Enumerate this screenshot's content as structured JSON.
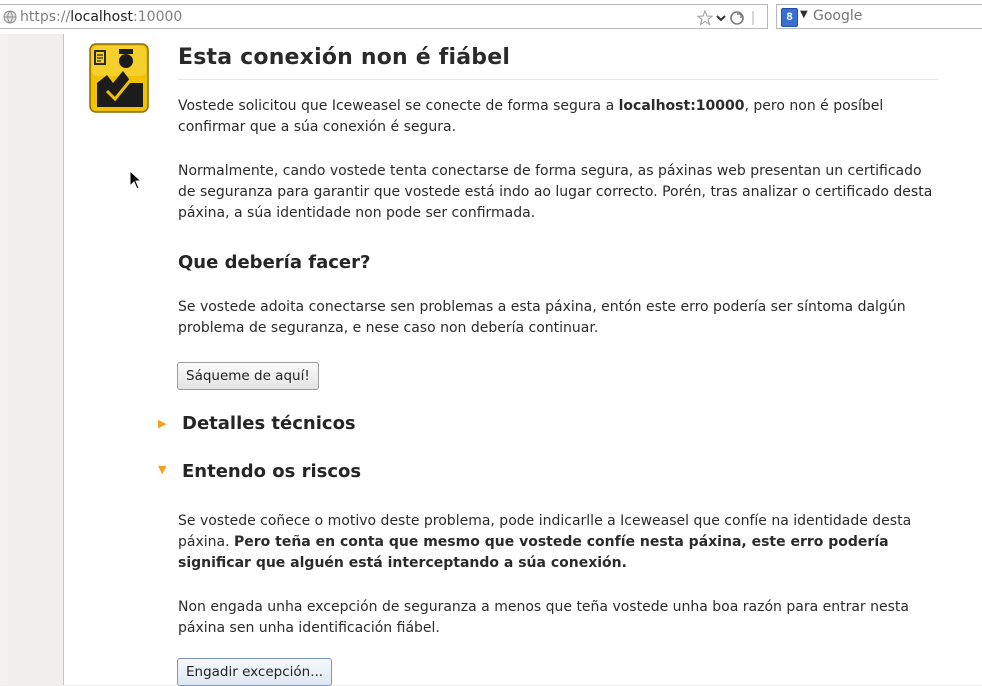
{
  "toolbar": {
    "url_prefix": "https://",
    "url_host": "localhost",
    "url_port": ":10000",
    "search_engine_badge": "8",
    "search_placeholder": "Google"
  },
  "page": {
    "title": "Esta conexión non é fiábel",
    "intro_before": "Vostede solicitou que Iceweasel se conecte de forma segura a ",
    "intro_host": "localhost:10000",
    "intro_after": ", pero non é posíbel confirmar que a súa conexión é segura.",
    "normal_text": "Normalmente, cando vostede tenta conectarse de forma segura, as páxinas web presentan un certificado de seguranza para garantir que vostede está indo ao lugar correcto. Porén, tras analizar o certificado desta páxina, a súa identidade non pode ser confirmada.",
    "what_heading": "Que debería facer?",
    "what_text": "Se vostede adoita conectarse sen problemas a esta páxina, entón este erro podería ser síntoma dalgún problema de seguranza, e nese caso non debería continuar.",
    "get_me_out_label": "Sáqueme de aquí!",
    "technical_details_label": "Detalles técnicos",
    "risks_label": "Entendo os riscos",
    "risks_text_before": "Se vostede coñece o motivo deste problema, pode indicarlle a Iceweasel que confíe na identidade desta páxina. ",
    "risks_text_bold": "Pero teña en conta que mesmo que vostede confíe nesta páxina, este erro podería significar que alguén está interceptando a súa conexión.",
    "exception_text": "Non engada unha excepción de seguranza a menos que teña vostede unha boa razón para entrar nesta páxina sen unha identificación fiábel.",
    "add_exception_label": "Engadir excepción..."
  },
  "colors": {
    "accent_triangle": "#f0a21e",
    "icon_yellow": "#f5c400",
    "badge_blue": "#3a6fd2"
  }
}
